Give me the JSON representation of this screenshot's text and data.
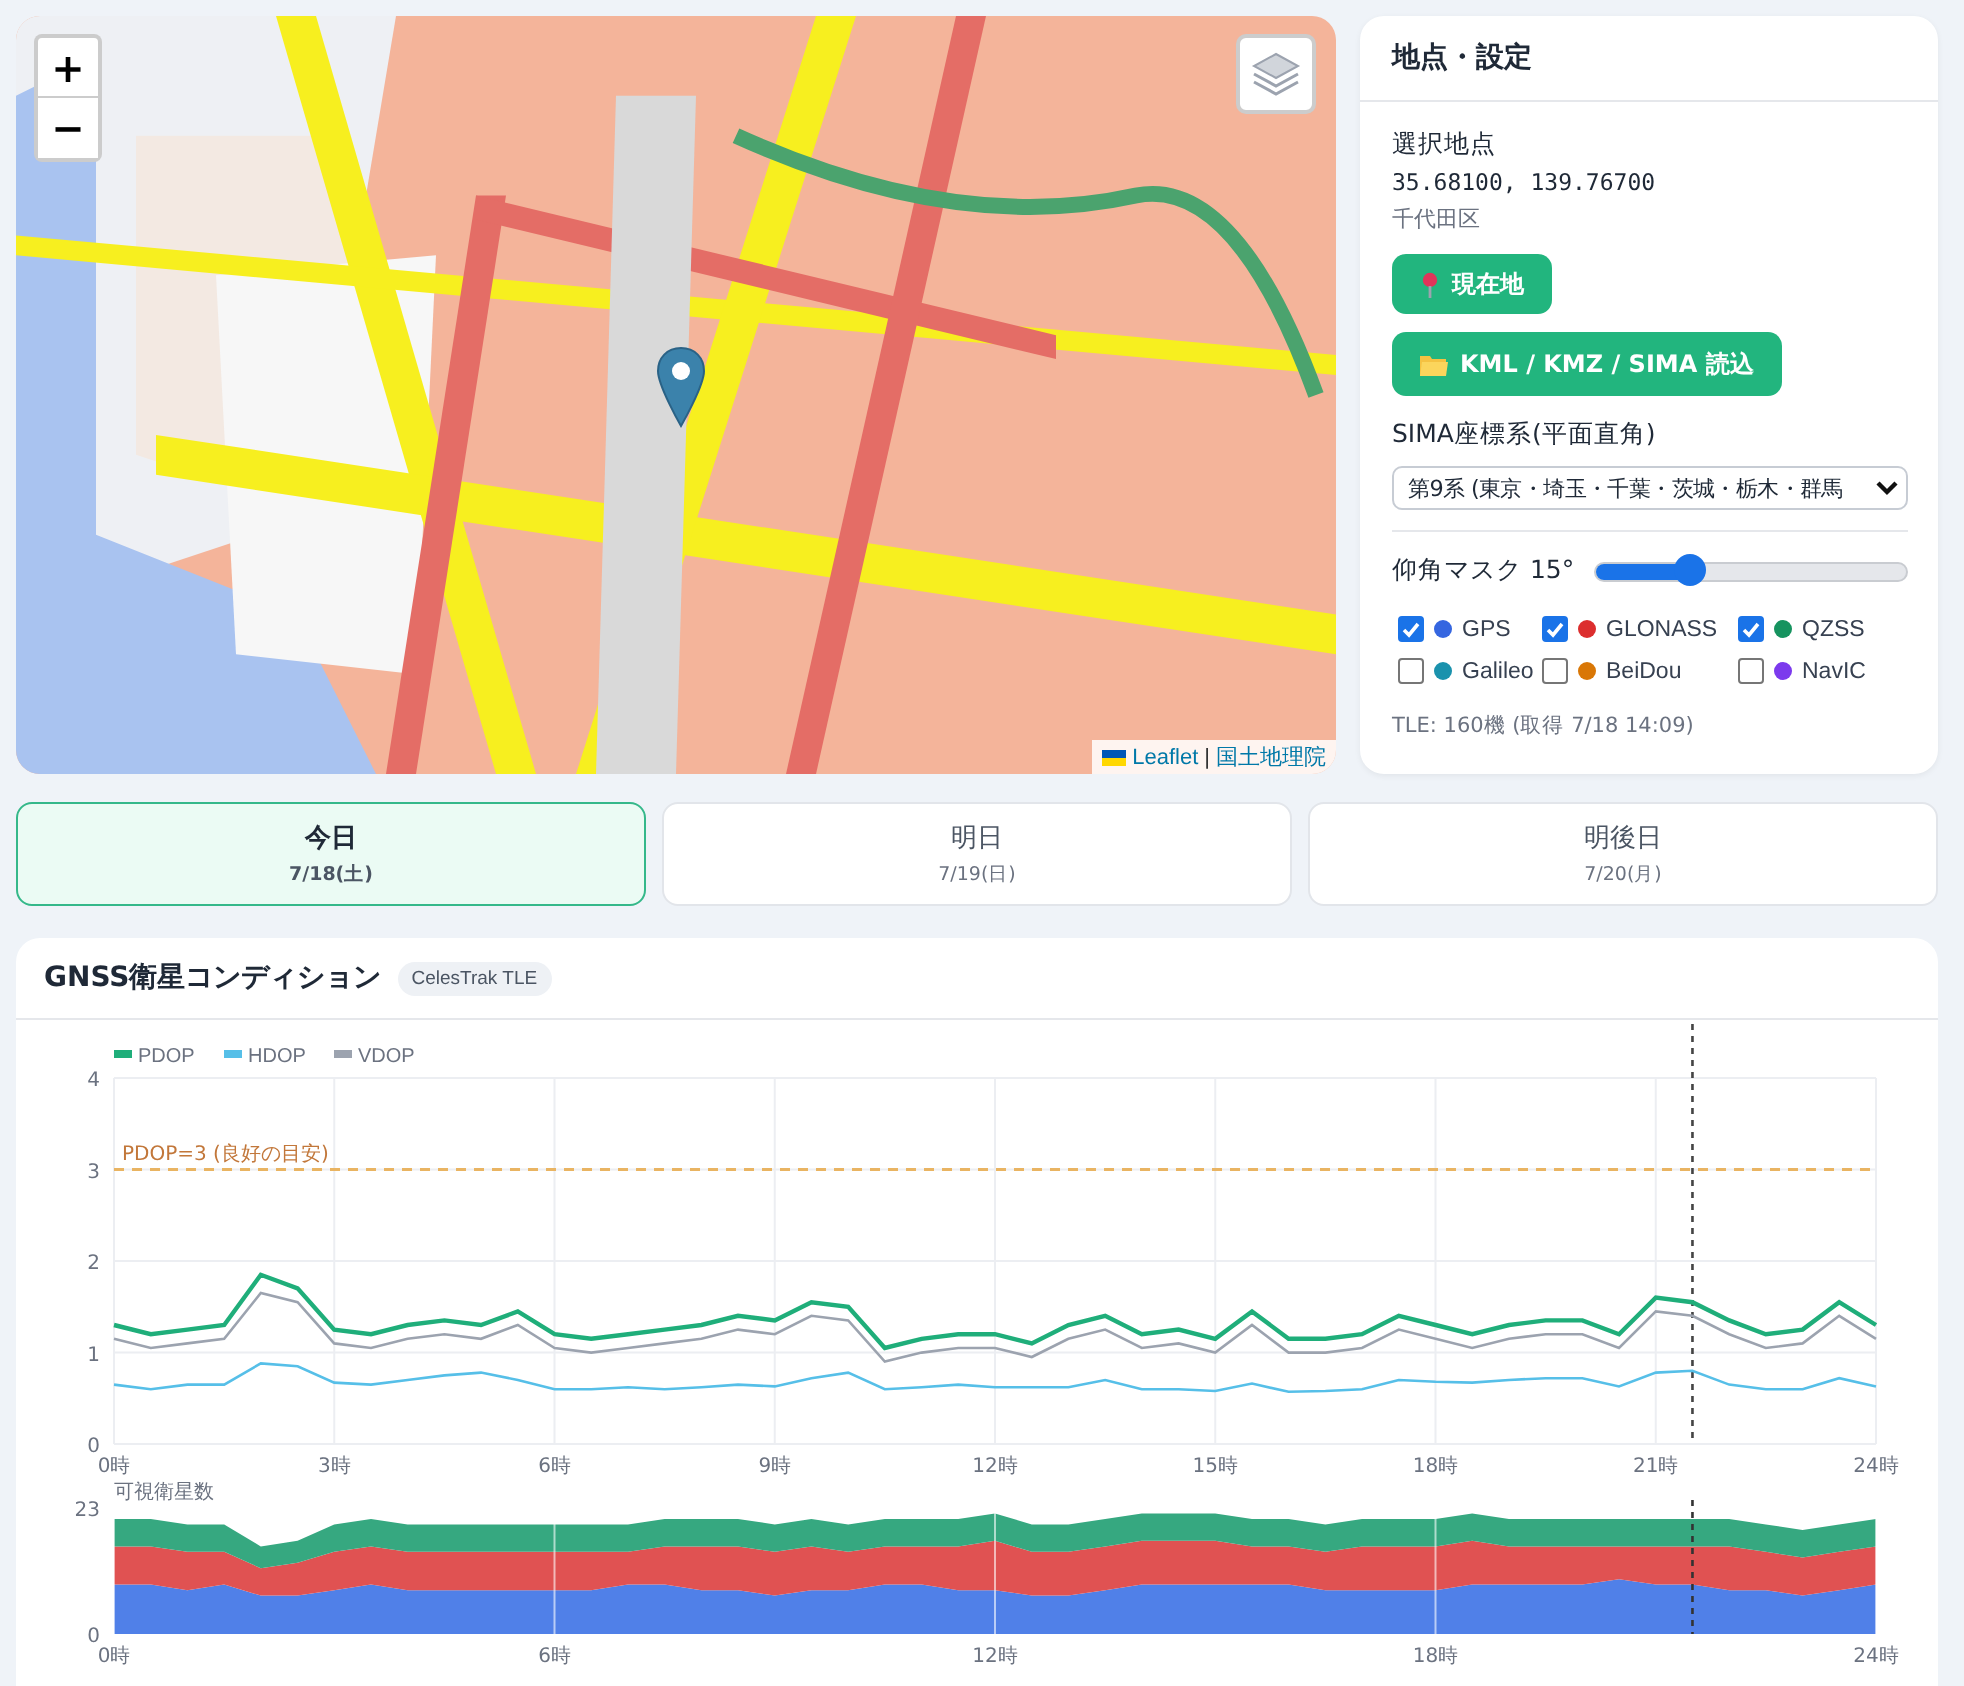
{
  "map": {
    "zoom_in": "+",
    "zoom_out": "−",
    "attribution": {
      "leaflet": "Leaflet",
      "separator": "|",
      "source": "国土地理院"
    }
  },
  "settings": {
    "title": "地点・設定",
    "location_label": "選択地点",
    "coords": "35.68100, 139.76700",
    "area": "千代田区",
    "buttons": [
      {
        "kind": "pin",
        "label": "現在地"
      },
      {
        "kind": "folder",
        "label": "KML / KMZ / SIMA 読込"
      }
    ],
    "select_label": "SIMA座標系(平面直角)",
    "select_value": "第9系 (東京・埼玉・千葉・茨城・栃木・群馬",
    "mask": {
      "label": "仰角マスク 15°",
      "level": 0.3
    },
    "constellations": [
      {
        "name": "GPS",
        "checked": true,
        "color": "#3566e0"
      },
      {
        "name": "GLONASS",
        "checked": true,
        "color": "#dc2e2e"
      },
      {
        "name": "QZSS",
        "checked": true,
        "color": "#16935f"
      },
      {
        "name": "Galileo",
        "checked": false,
        "color": "#1a92ad"
      },
      {
        "name": "BeiDou",
        "checked": false,
        "color": "#d97706"
      },
      {
        "name": "NavIC",
        "checked": false,
        "color": "#7c3aed"
      }
    ],
    "tle_note": "TLE: 160機 (取得 7/18 14:09)"
  },
  "day_tabs": [
    {
      "label": "今日",
      "date": "7/18(土)",
      "selected": true
    },
    {
      "label": "明日",
      "date": "7/19(日)",
      "selected": false
    },
    {
      "label": "明後日",
      "date": "7/20(月)",
      "selected": false
    }
  ],
  "gnss": {
    "title": "GNSS衛星コンディション",
    "badge": "CelesTrak TLE",
    "chart_data": {
      "type": "line",
      "x": [
        0,
        0.5,
        1,
        1.5,
        2,
        2.5,
        3,
        3.5,
        4,
        4.5,
        5,
        5.5,
        6,
        6.5,
        7,
        7.5,
        8,
        8.5,
        9,
        9.5,
        10,
        10.5,
        11,
        11.5,
        12,
        12.5,
        13,
        13.5,
        14,
        14.5,
        15,
        15.5,
        16,
        16.5,
        17,
        17.5,
        18,
        18.5,
        19,
        19.5,
        20,
        20.5,
        21,
        21.5,
        22,
        22.5,
        23,
        23.5,
        24
      ],
      "series": [
        {
          "name": "PDOP",
          "color": "#1fae7a",
          "values": [
            1.3,
            1.2,
            1.25,
            1.3,
            1.85,
            1.7,
            1.25,
            1.2,
            1.3,
            1.35,
            1.3,
            1.45,
            1.2,
            1.15,
            1.2,
            1.25,
            1.3,
            1.4,
            1.35,
            1.55,
            1.5,
            1.05,
            1.15,
            1.2,
            1.2,
            1.1,
            1.3,
            1.4,
            1.2,
            1.25,
            1.15,
            1.45,
            1.15,
            1.15,
            1.2,
            1.4,
            1.3,
            1.2,
            1.3,
            1.35,
            1.35,
            1.2,
            1.6,
            1.55,
            1.35,
            1.2,
            1.25,
            1.55,
            1.3
          ]
        },
        {
          "name": "HDOP",
          "color": "#56bfe8",
          "values": [
            0.65,
            0.6,
            0.65,
            0.65,
            0.88,
            0.85,
            0.67,
            0.65,
            0.7,
            0.75,
            0.78,
            0.7,
            0.6,
            0.6,
            0.62,
            0.6,
            0.62,
            0.65,
            0.63,
            0.72,
            0.78,
            0.6,
            0.62,
            0.65,
            0.62,
            0.62,
            0.62,
            0.7,
            0.6,
            0.6,
            0.58,
            0.66,
            0.57,
            0.58,
            0.6,
            0.7,
            0.68,
            0.67,
            0.7,
            0.72,
            0.72,
            0.63,
            0.78,
            0.8,
            0.65,
            0.6,
            0.6,
            0.72,
            0.63
          ]
        },
        {
          "name": "VDOP",
          "color": "#9ca3af",
          "values": [
            1.15,
            1.05,
            1.1,
            1.15,
            1.65,
            1.55,
            1.1,
            1.05,
            1.15,
            1.2,
            1.15,
            1.3,
            1.05,
            1.0,
            1.05,
            1.1,
            1.15,
            1.25,
            1.2,
            1.4,
            1.35,
            0.9,
            1.0,
            1.05,
            1.05,
            0.95,
            1.15,
            1.25,
            1.05,
            1.1,
            1.0,
            1.3,
            1.0,
            1.0,
            1.05,
            1.25,
            1.15,
            1.05,
            1.15,
            1.2,
            1.2,
            1.05,
            1.45,
            1.4,
            1.2,
            1.05,
            1.1,
            1.4,
            1.15
          ]
        }
      ],
      "xlim": [
        0,
        24
      ],
      "ylim": [
        0,
        4
      ],
      "yticks": [
        0,
        1,
        2,
        3,
        4
      ],
      "xticks": [
        {
          "value": 0,
          "label": "0時"
        },
        {
          "value": 3,
          "label": "3時"
        },
        {
          "value": 6,
          "label": "6時"
        },
        {
          "value": 9,
          "label": "9時"
        },
        {
          "value": 12,
          "label": "12時"
        },
        {
          "value": 15,
          "label": "15時"
        },
        {
          "value": 18,
          "label": "18時"
        },
        {
          "value": 21,
          "label": "21時"
        },
        {
          "value": 24,
          "label": "24時"
        }
      ],
      "grid": true,
      "legend": true,
      "ref_lines": [
        {
          "axis": "y",
          "value": 3,
          "label": "PDOP=3 (良好の目安)"
        },
        {
          "axis": "x",
          "value": 21.5
        }
      ]
    },
    "count_chart": {
      "chart_data": {
        "type": "area",
        "stacked": true,
        "ylabel": "可視衛星数",
        "x": [
          0,
          0.5,
          1,
          1.5,
          2,
          2.5,
          3,
          3.5,
          4,
          4.5,
          5,
          5.5,
          6,
          6.5,
          7,
          7.5,
          8,
          8.5,
          9,
          9.5,
          10,
          10.5,
          11,
          11.5,
          12,
          12.5,
          13,
          13.5,
          14,
          14.5,
          15,
          15.5,
          16,
          16.5,
          17,
          17.5,
          18,
          18.5,
          19,
          19.5,
          20,
          20.5,
          21,
          21.5,
          22,
          22.5,
          23,
          23.5,
          24
        ],
        "series": [
          {
            "color": "#5080e8",
            "values": [
              9,
              9,
              8,
              9,
              7,
              7,
              8,
              9,
              8,
              8,
              8,
              8,
              8,
              8,
              9,
              9,
              8,
              8,
              7,
              8,
              8,
              9,
              9,
              8,
              8,
              7,
              7,
              8,
              9,
              9,
              9,
              9,
              9,
              8,
              8,
              8,
              8,
              9,
              9,
              9,
              9,
              10,
              9,
              9,
              8,
              8,
              7,
              8,
              9
            ]
          },
          {
            "color": "#e05252",
            "values": [
              7,
              7,
              7,
              6,
              5,
              6,
              7,
              7,
              7,
              7,
              7,
              7,
              7,
              7,
              6,
              7,
              8,
              8,
              8,
              8,
              7,
              7,
              7,
              8,
              9,
              8,
              8,
              8,
              8,
              8,
              8,
              7,
              7,
              7,
              8,
              8,
              8,
              8,
              7,
              7,
              7,
              6,
              7,
              7,
              8,
              7,
              7,
              7,
              7
            ]
          },
          {
            "color": "#36a880",
            "values": [
              5,
              5,
              5,
              5,
              4,
              4,
              5,
              5,
              5,
              5,
              5,
              5,
              5,
              5,
              5,
              5,
              5,
              5,
              5,
              5,
              5,
              5,
              5,
              5,
              5,
              5,
              5,
              5,
              5,
              5,
              5,
              5,
              5,
              5,
              5,
              5,
              5,
              5,
              5,
              5,
              5,
              5,
              5,
              5,
              5,
              5,
              5,
              5,
              5
            ]
          }
        ],
        "xlim": [
          0,
          24
        ],
        "ylim": [
          0,
          23
        ],
        "yticks": [
          0,
          23
        ],
        "xticks": [
          {
            "value": 0,
            "label": "0時"
          },
          {
            "value": 6,
            "label": "6時"
          },
          {
            "value": 12,
            "label": "12時"
          },
          {
            "value": 18,
            "label": "18時"
          },
          {
            "value": 24,
            "label": "24時"
          }
        ],
        "grid": true,
        "ref_lines": [
          {
            "axis": "x",
            "value": 21.5
          }
        ]
      }
    }
  }
}
